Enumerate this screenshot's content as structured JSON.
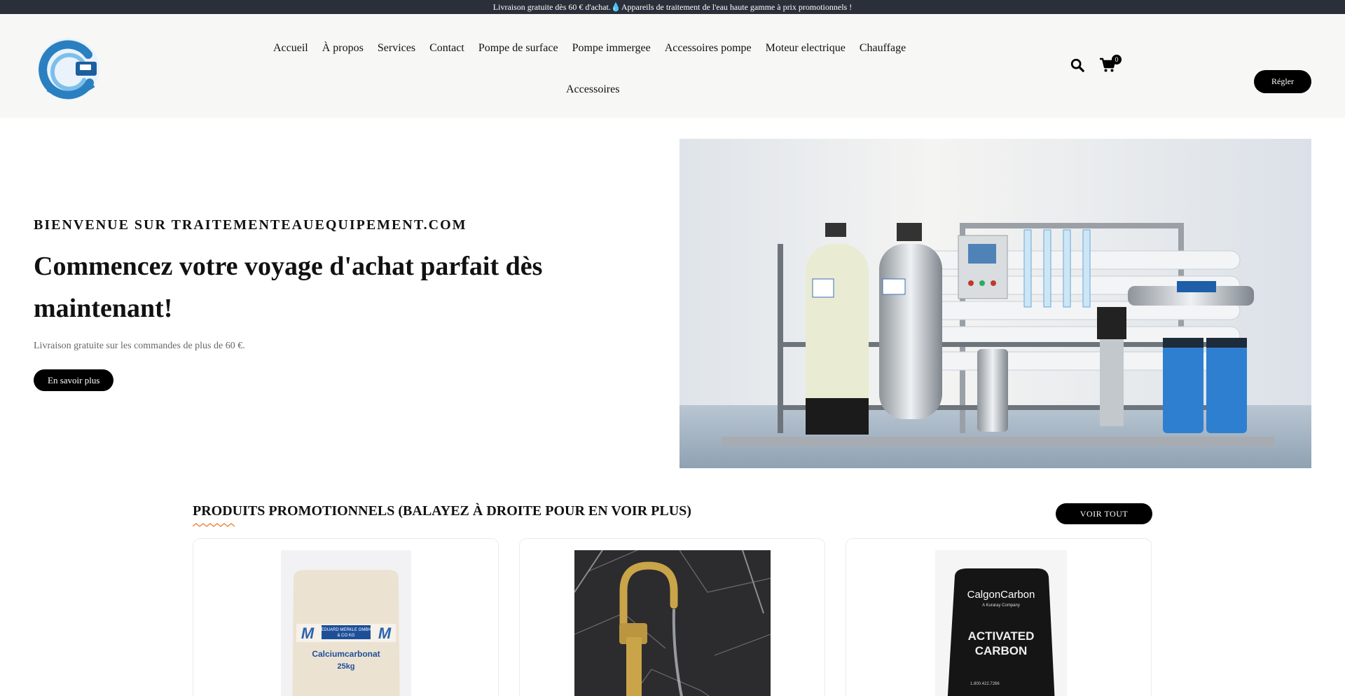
{
  "topbar": {
    "text": "Livraison gratuite dès 60 € d'achat.💧Appareils de traitement de l'eau haute gamme à prix promotionnels !"
  },
  "nav": {
    "row1": [
      "Accueil",
      "À propos",
      "Services",
      "Contact",
      "Pompe de surface",
      "Pompe immergee",
      "Accessoires pompe",
      "Moteur electrique",
      "Chauffage"
    ],
    "row2": [
      "Accessoires"
    ],
    "cart_count": "0",
    "settle_label": "Régler"
  },
  "icons": {
    "search": "search-icon",
    "cart": "cart-icon"
  },
  "hero": {
    "eyebrow": "BIENVENUE SUR TRAITEMENTEAUEQUIPEMENT.COM",
    "title": "Commencez votre voyage d'achat parfait dès maintenant!",
    "subtitle": "Livraison gratuite sur les commandes de plus de 60 €.",
    "button": "En savoir plus"
  },
  "promo": {
    "title": "PRODUITS PROMOTIONNELS (BALAYEZ À DROITE POUR EN VOIR PLUS)",
    "view_all": "VOIR TOUT",
    "products": [
      {
        "bag_brand": "EDUARD MERKLE GMBH & CO KG",
        "bag_product": "Calciumcarbonat",
        "bag_weight": "25kg"
      },
      {
        "image": "gold-faucet"
      },
      {
        "bag_brand": "CalgonCarbon",
        "bag_tagline": "A Kuraray Company",
        "bag_product_line1": "ACTIVATED",
        "bag_product_line2": "CARBON",
        "bag_phone": "1.800.422.7266"
      }
    ]
  },
  "colors": {
    "topbar": "#2b2f3a",
    "header_bg": "#f7f7f5",
    "button": "#000000",
    "accent_wave": "#e8833a"
  }
}
